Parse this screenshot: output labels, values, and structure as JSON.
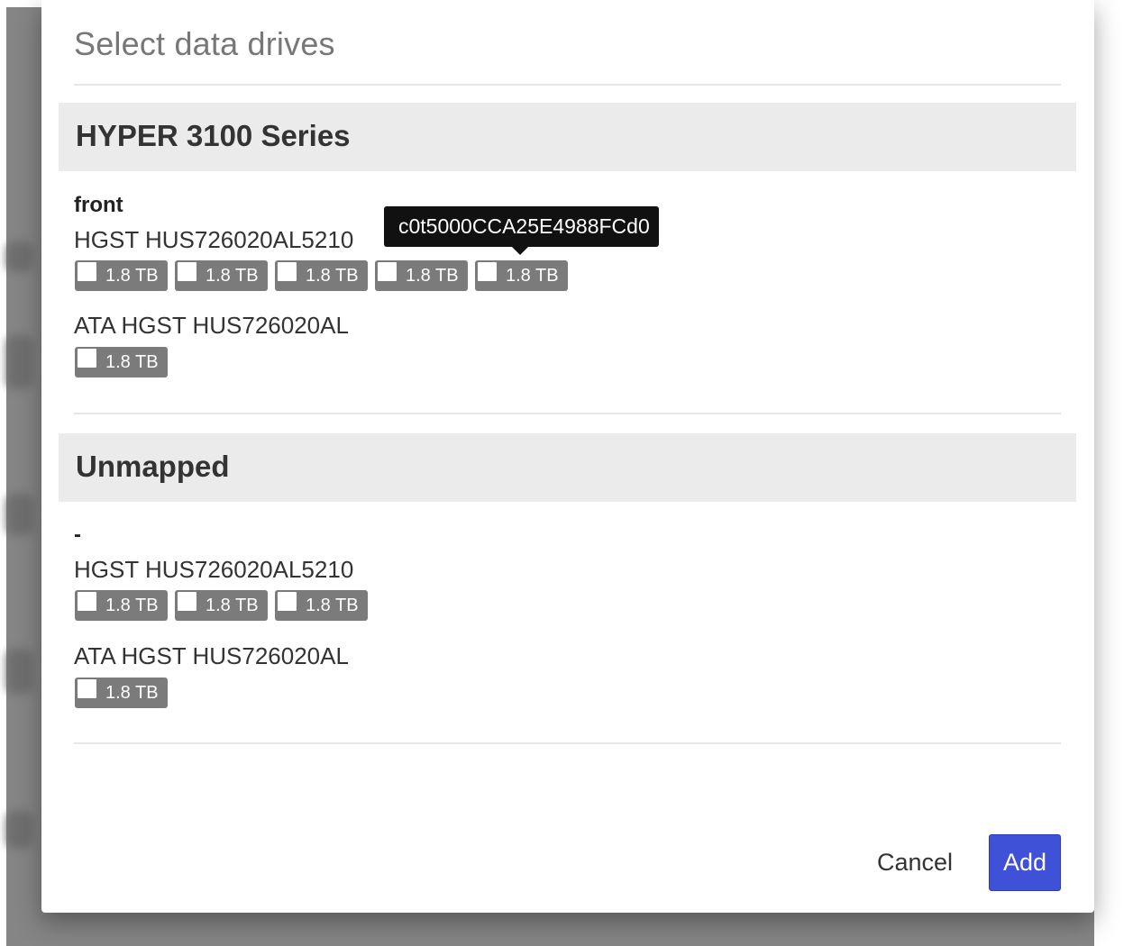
{
  "dialog": {
    "title": "Select data drives"
  },
  "groups": [
    {
      "name": "HYPER 3100 Series",
      "location": "front",
      "models": [
        {
          "name": "HGST HUS726020AL5210",
          "disks": [
            "1.8 TB",
            "1.8 TB",
            "1.8 TB",
            "1.8 TB",
            "1.8 TB"
          ]
        },
        {
          "name": "ATA HGST HUS726020AL",
          "disks": [
            "1.8 TB"
          ]
        }
      ]
    },
    {
      "name": "Unmapped",
      "location": "-",
      "models": [
        {
          "name": "HGST HUS726020AL5210",
          "disks": [
            "1.8 TB",
            "1.8 TB",
            "1.8 TB"
          ]
        },
        {
          "name": "ATA HGST HUS726020AL",
          "disks": [
            "1.8 TB"
          ]
        }
      ]
    }
  ],
  "tooltip": {
    "text": "c0t5000CCA25E4988FCd0"
  },
  "actions": {
    "cancel_label": "Cancel",
    "add_label": "Add"
  },
  "colors": {
    "accent": "#3f51d6",
    "disk_chip": "#7b7b7b",
    "group_header_bg": "#ebebeb",
    "tooltip_bg": "#111111"
  }
}
